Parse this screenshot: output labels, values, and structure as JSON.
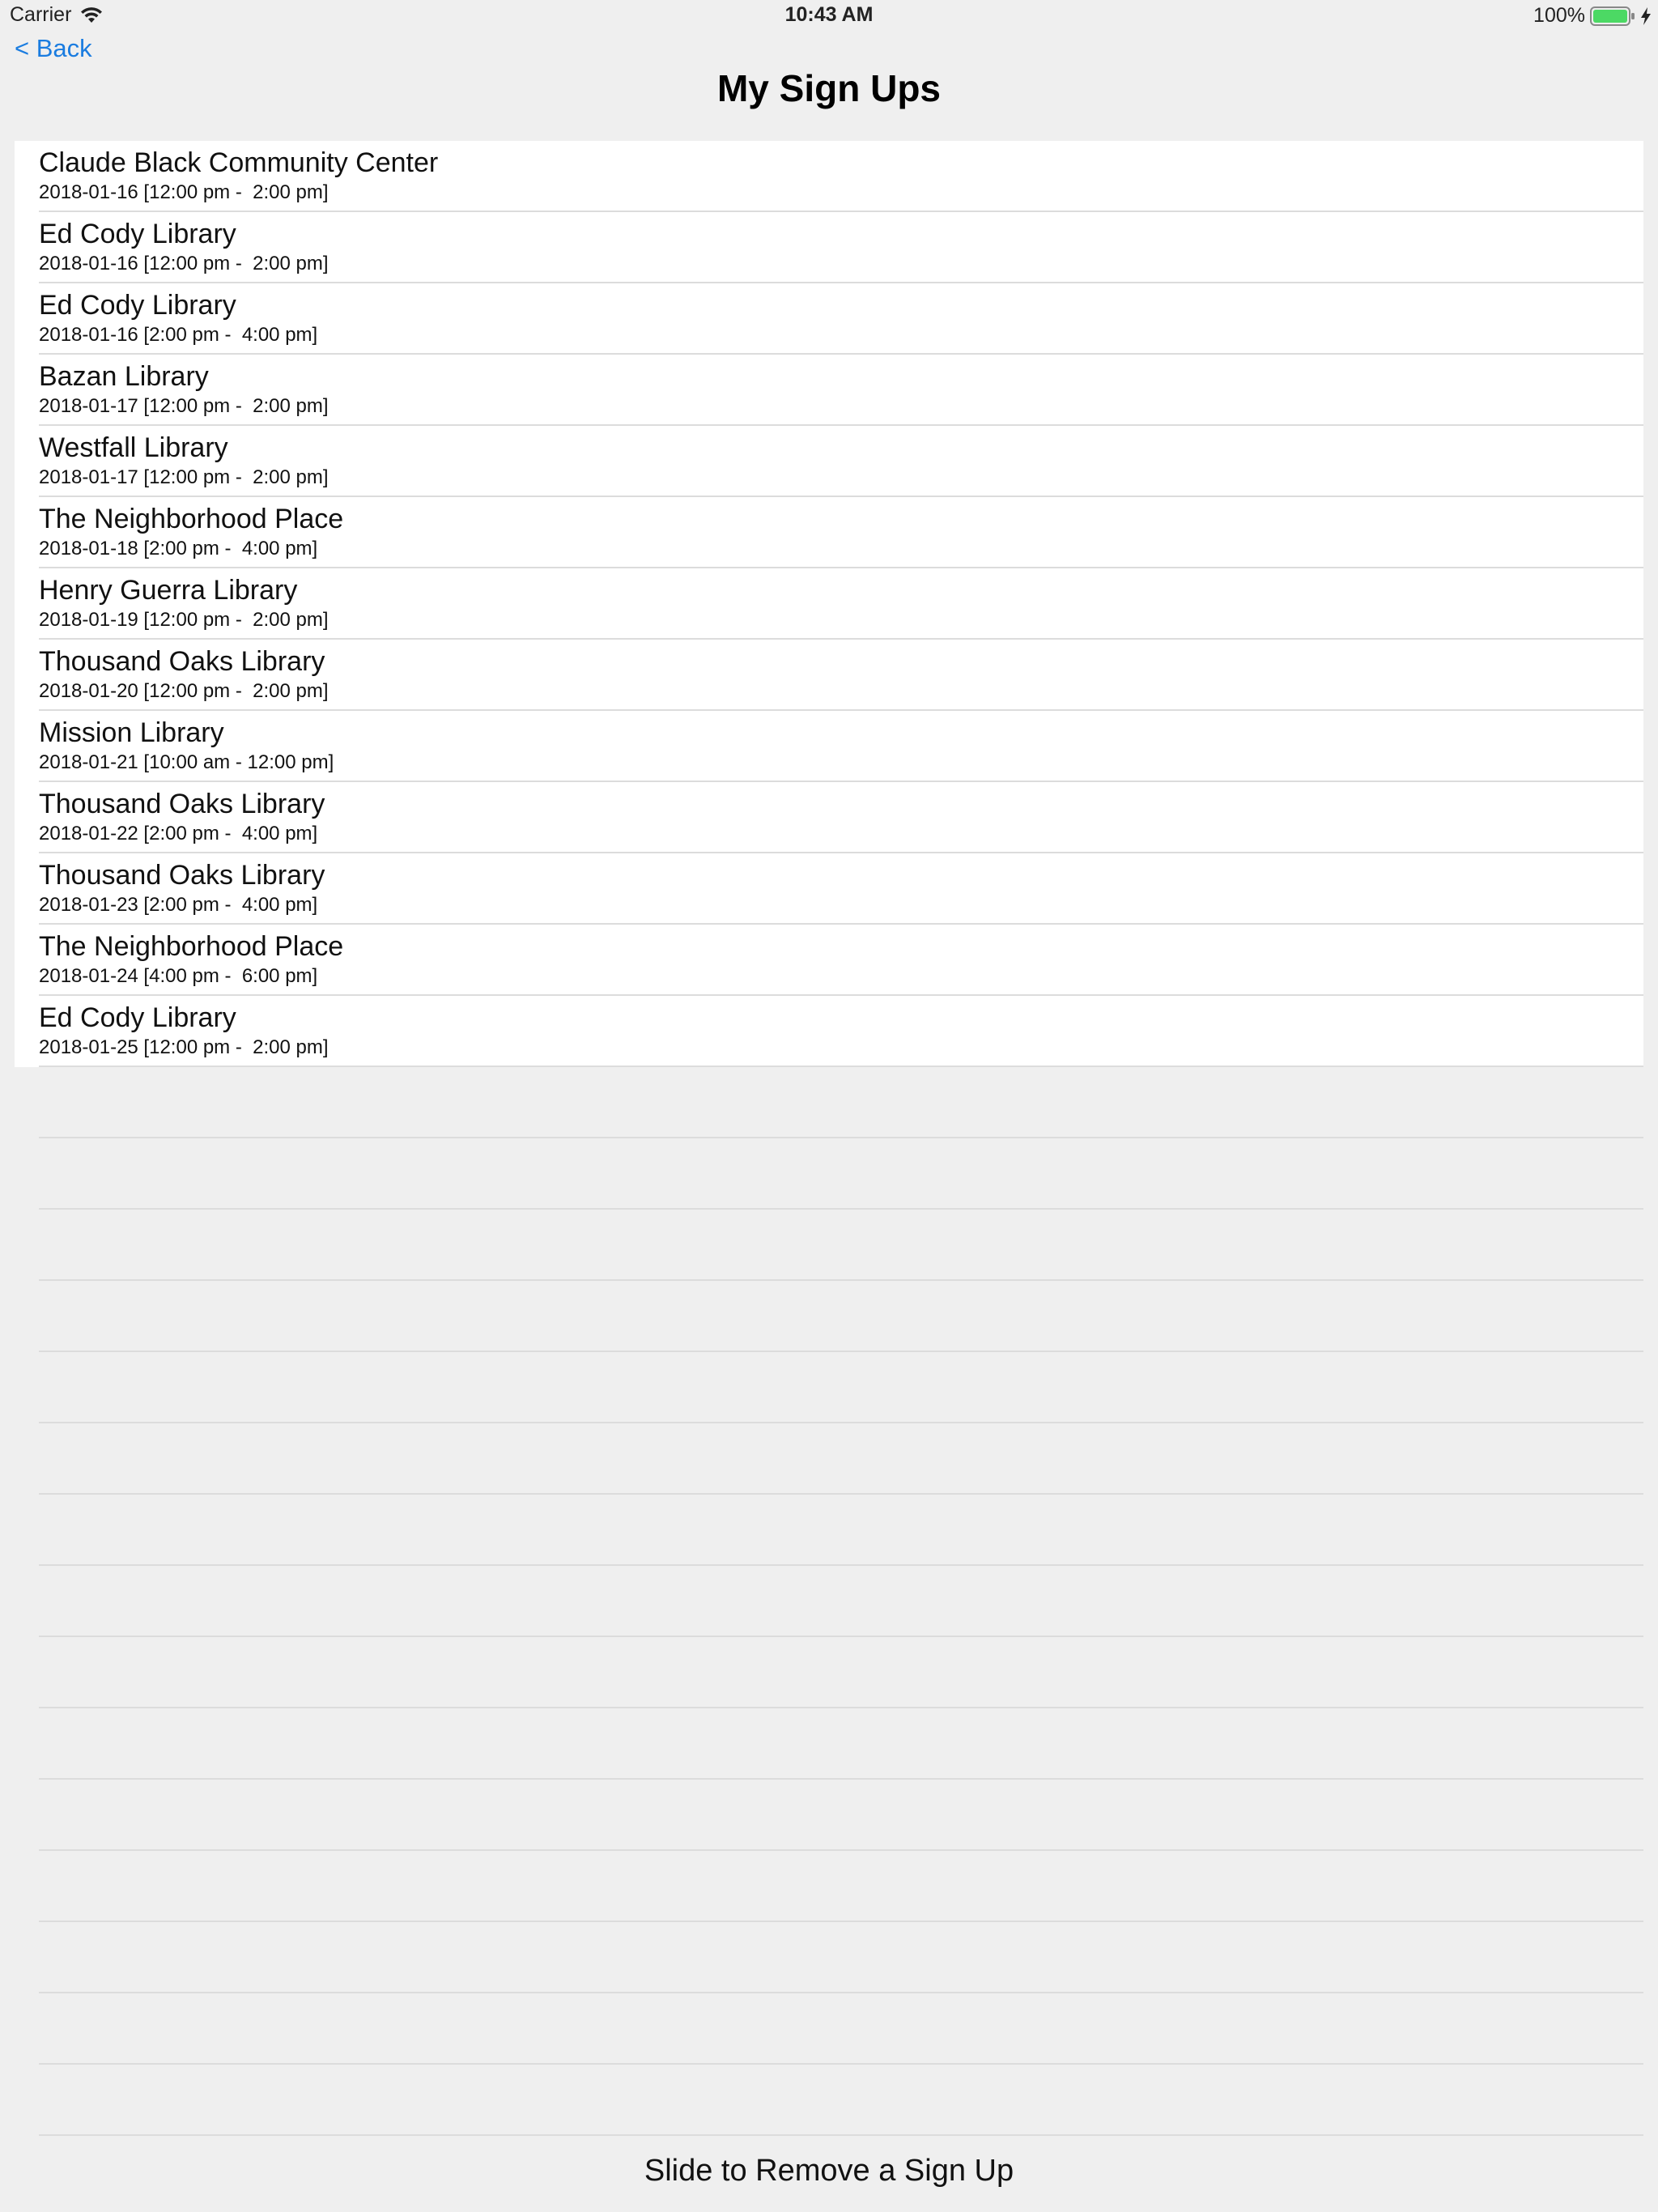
{
  "status_bar": {
    "carrier": "Carrier",
    "time": "10:43 AM",
    "battery": "100%",
    "icons": [
      "wifi-icon",
      "battery-icon",
      "charging-bolt-icon"
    ],
    "battery_color": "#4cd964"
  },
  "nav": {
    "back_label": "< Back",
    "title": "My Sign Ups",
    "accent_color": "#1a7ce0"
  },
  "signups": [
    {
      "location": "Claude Black Community Center",
      "time": "2018-01-16 [12:00 pm -  2:00 pm]"
    },
    {
      "location": "Ed Cody Library",
      "time": "2018-01-16 [12:00 pm -  2:00 pm]"
    },
    {
      "location": "Ed Cody Library",
      "time": "2018-01-16 [2:00 pm -  4:00 pm]"
    },
    {
      "location": "Bazan Library",
      "time": "2018-01-17 [12:00 pm -  2:00 pm]"
    },
    {
      "location": "Westfall Library",
      "time": "2018-01-17 [12:00 pm -  2:00 pm]"
    },
    {
      "location": "The Neighborhood Place",
      "time": "2018-01-18 [2:00 pm -  4:00 pm]"
    },
    {
      "location": "Henry Guerra Library",
      "time": "2018-01-19 [12:00 pm -  2:00 pm]"
    },
    {
      "location": "Thousand Oaks Library",
      "time": "2018-01-20 [12:00 pm -  2:00 pm]"
    },
    {
      "location": "Mission Library",
      "time": "2018-01-21 [10:00 am - 12:00 pm]"
    },
    {
      "location": "Thousand Oaks Library",
      "time": "2018-01-22 [2:00 pm -  4:00 pm]"
    },
    {
      "location": "Thousand Oaks Library",
      "time": "2018-01-23 [2:00 pm -  4:00 pm]"
    },
    {
      "location": "The Neighborhood Place",
      "time": "2018-01-24 [4:00 pm -  6:00 pm]"
    },
    {
      "location": "Ed Cody Library",
      "time": "2018-01-25 [12:00 pm -  2:00 pm]"
    }
  ],
  "footer": {
    "hint": "Slide to Remove a Sign Up"
  }
}
